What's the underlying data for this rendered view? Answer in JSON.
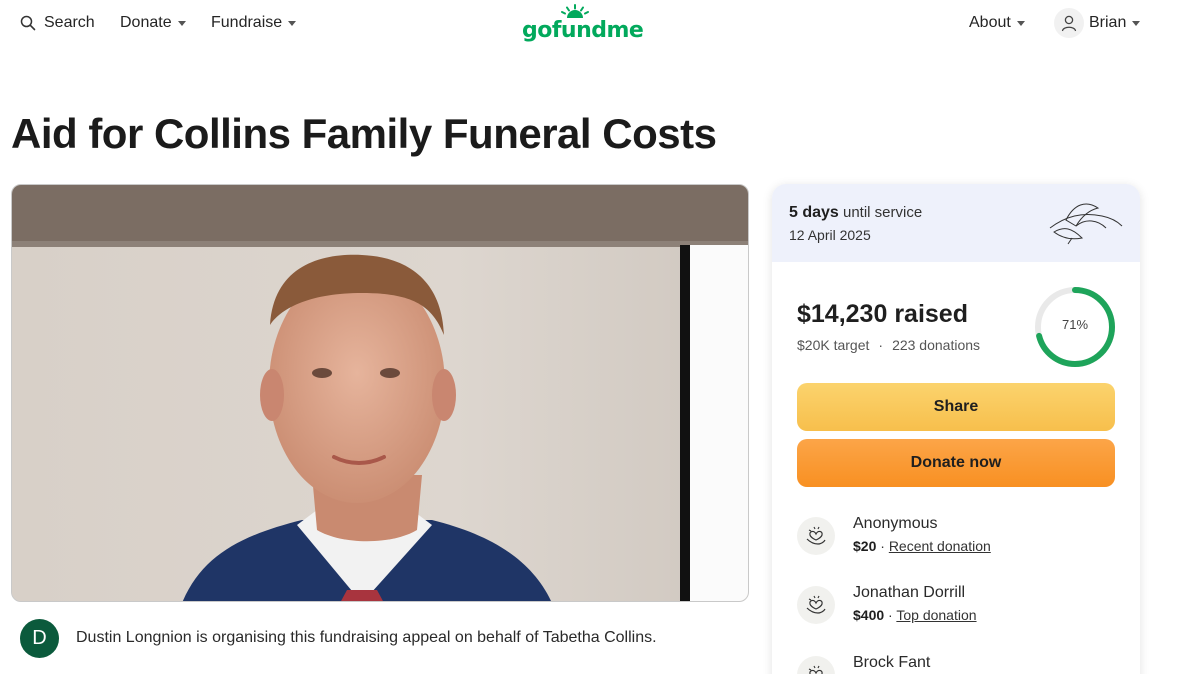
{
  "header": {
    "search_label": "Search",
    "donate_label": "Donate",
    "fundraise_label": "Fundraise",
    "logo_text": "gofundme",
    "about_label": "About",
    "user_name": "Brian",
    "brand_color": "#02a95c"
  },
  "campaign": {
    "title": "Aid for Collins Family Funeral Costs",
    "organizer_initial": "D",
    "organizer_text": "Dustin Longnion is organising this fundraising appeal on behalf of Tabetha Collins."
  },
  "sidebar": {
    "days_count": "5 days",
    "days_suffix": "until service",
    "service_date": "12 April 2025",
    "raised": "$14,230 raised",
    "target": "$20K target",
    "separator": "·",
    "donations_count": "223 donations",
    "progress_label": "71%",
    "progress_fraction": 0.71,
    "share_label": "Share",
    "donate_now_label": "Donate now",
    "donations": [
      {
        "name": "Anonymous",
        "amount": "$20",
        "sep": "·",
        "tag": "Recent donation"
      },
      {
        "name": "Jonathan Dorrill",
        "amount": "$400",
        "sep": "·",
        "tag": "Top donation"
      },
      {
        "name": "Brock Fant"
      }
    ]
  },
  "colors": {
    "share_button": "#f9c95a",
    "donate_button": "#fa9a36",
    "progress_ring": "#1ea45a",
    "service_band": "#eef1fb",
    "organizer_avatar": "#0b5a3c"
  }
}
